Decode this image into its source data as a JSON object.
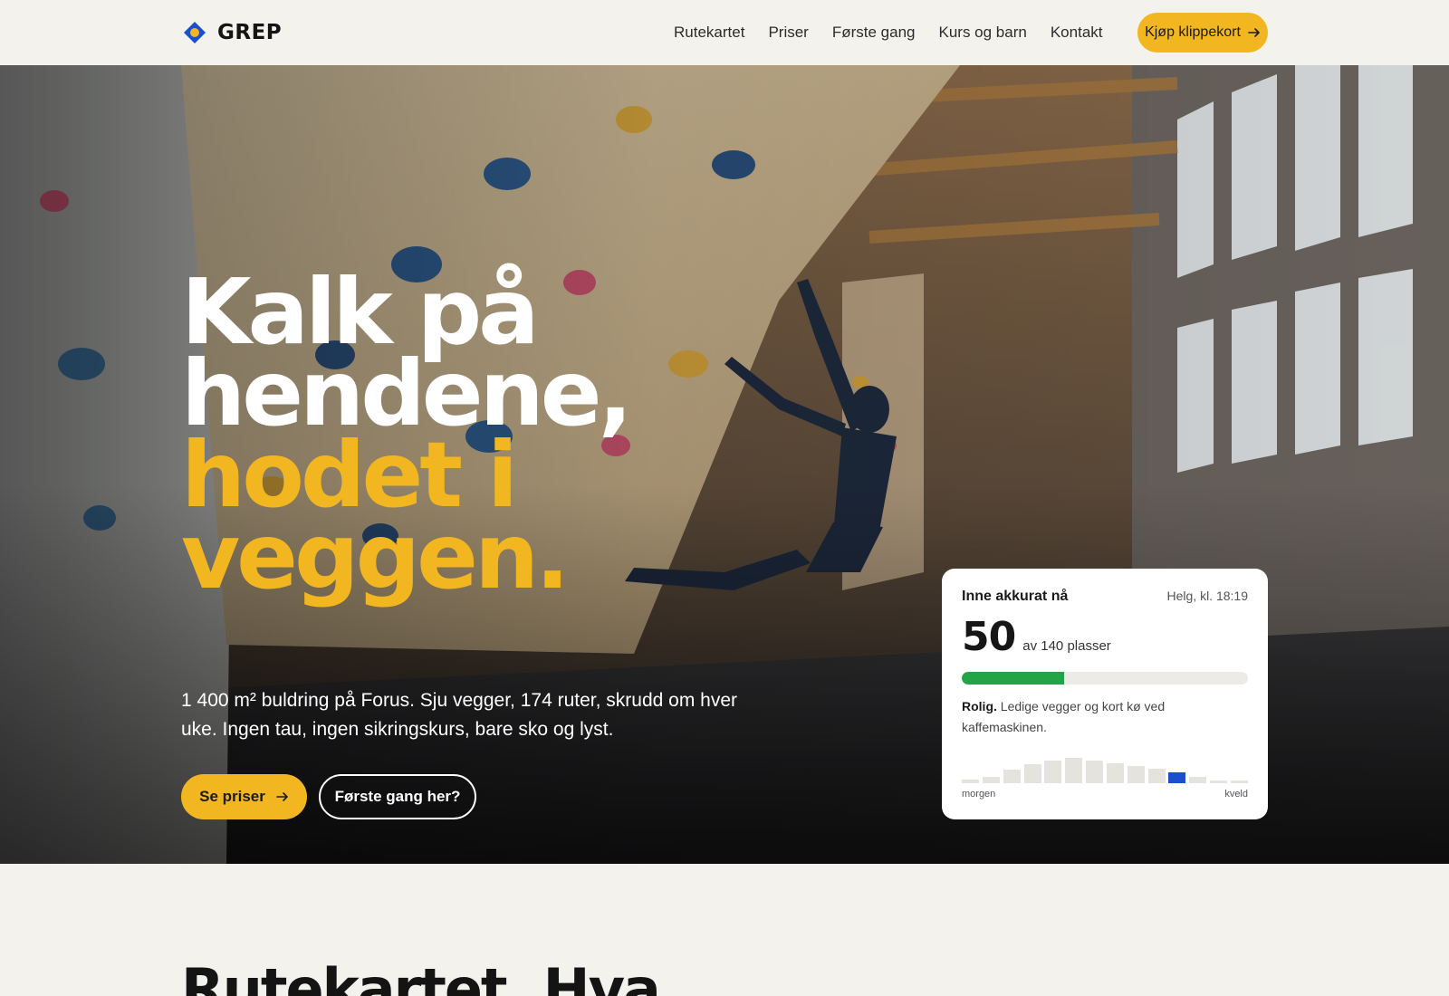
{
  "brand": {
    "name": "GREP"
  },
  "nav": {
    "items": [
      {
        "label": "Rutekartet"
      },
      {
        "label": "Priser"
      },
      {
        "label": "Første gang"
      },
      {
        "label": "Kurs og barn"
      },
      {
        "label": "Kontakt"
      }
    ],
    "cta_label": "Kjøp klippekort"
  },
  "hero": {
    "headline": [
      "Kalk på",
      "hendene,",
      "hodet i",
      "veggen."
    ],
    "lead": "1 400 m² buldring på Forus. Sju vegger, 174 ruter, skrudd om hver uke. Ingen tau, ingen sikringskurs, bare sko og lyst.",
    "primary_label": "Se priser",
    "secondary_label": "Første gang her?"
  },
  "occupancy": {
    "title": "Inne akkurat nå",
    "time": "Helg, kl. 18:19",
    "count": "50",
    "capacity_text": "av 140 plasser",
    "fraction": 0.357,
    "status_strong": "Rolig.",
    "status_text": "Ledige vegger og kort kø ved kaffemaskinen.",
    "hourly_levels": [
      0.12,
      0.22,
      0.5,
      0.7,
      0.85,
      0.92,
      0.85,
      0.72,
      0.65,
      0.55,
      0.4,
      0.22,
      0.1,
      0.1
    ],
    "current_index": 10,
    "label_start": "morgen",
    "label_end": "kveld"
  },
  "next_section": {
    "title": "Rutekartet. Hva"
  },
  "colors": {
    "accent": "#f2b620",
    "meter": "#22a447",
    "current_bar": "#1a4fd0",
    "page_bg": "#f4f2ec"
  }
}
